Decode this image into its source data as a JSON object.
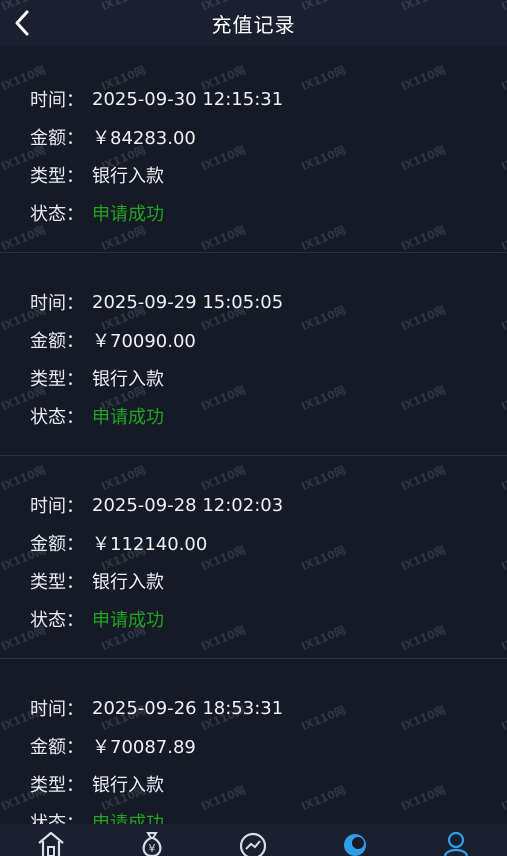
{
  "header": {
    "title": "充值记录"
  },
  "labels": {
    "time": "时间：",
    "amount": "金额：",
    "type": "类型：",
    "status": "状态："
  },
  "records": [
    {
      "time": "2025-09-30 12:15:31",
      "amount": "￥84283.00",
      "type": "银行入款",
      "status": "申请成功"
    },
    {
      "time": "2025-09-29 15:05:05",
      "amount": "￥70090.00",
      "type": "银行入款",
      "status": "申请成功"
    },
    {
      "time": "2025-09-28 12:02:03",
      "amount": "￥112140.00",
      "type": "银行入款",
      "status": "申请成功"
    },
    {
      "time": "2025-09-26 18:53:31",
      "amount": "￥70087.89",
      "type": "银行入款",
      "status": "申请成功"
    }
  ],
  "tabbar": {
    "icons": [
      "home-icon",
      "money-bag-icon",
      "chart-icon",
      "chat-icon",
      "user-icon"
    ],
    "active_color": "#2f9ee8",
    "inactive_color": "#d9dde6"
  },
  "watermark": {
    "text": "IX110网"
  },
  "colors": {
    "success": "#1fa51f",
    "background": "#161a26"
  }
}
